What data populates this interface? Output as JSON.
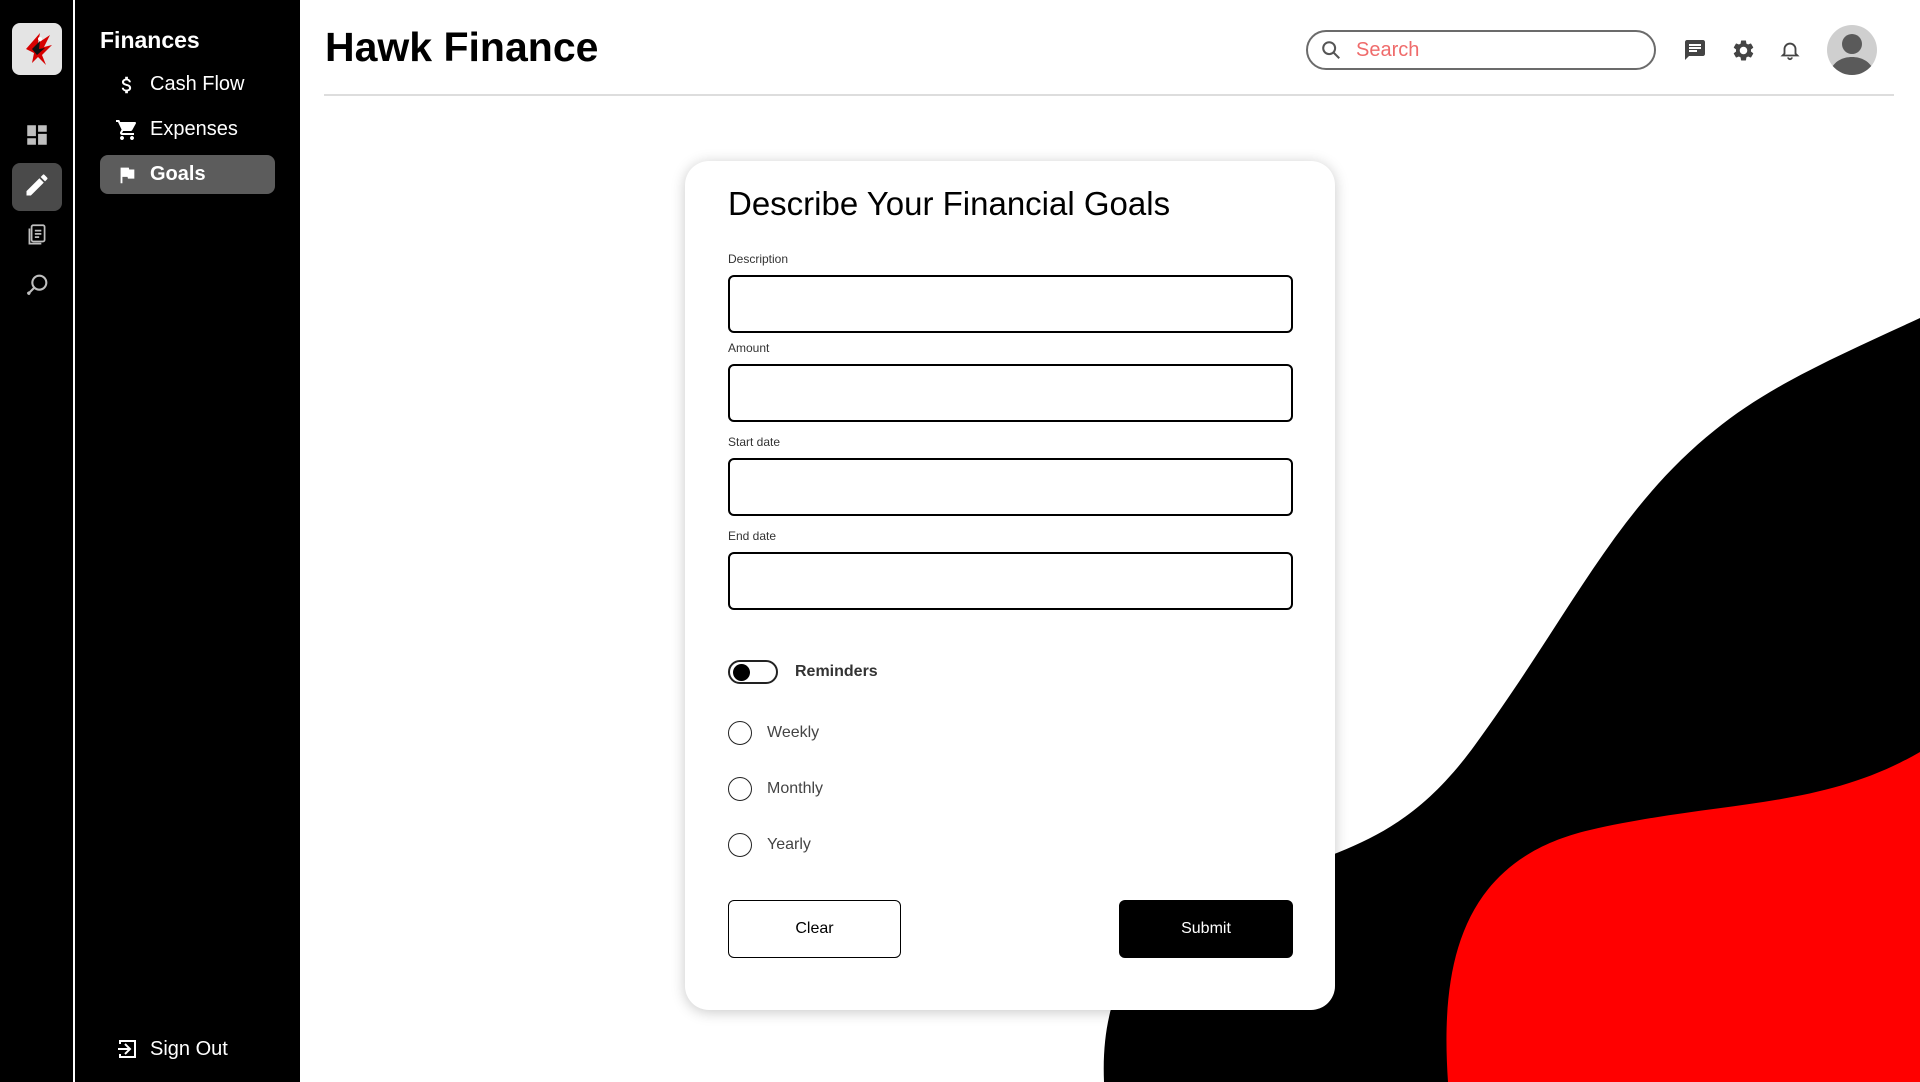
{
  "app": {
    "title": "Hawk Finance"
  },
  "colors": {
    "accent": "#ff0000",
    "dark": "#000000",
    "active_nav": "#5c5c5c"
  },
  "rail": {
    "logo": "hawk-logo",
    "items": [
      {
        "icon": "dashboard-icon",
        "active": false
      },
      {
        "icon": "pencil-icon",
        "active": true
      },
      {
        "icon": "documents-icon",
        "active": false
      },
      {
        "icon": "search-tag-icon",
        "active": false
      }
    ]
  },
  "nav": {
    "title": "Finances",
    "items": [
      {
        "label": "Cash Flow",
        "icon": "dollar-icon",
        "active": false
      },
      {
        "label": "Expenses",
        "icon": "cart-icon",
        "active": false
      },
      {
        "label": "Goals",
        "icon": "flag-icon",
        "active": true
      }
    ],
    "sign_out": "Sign Out"
  },
  "header": {
    "search_placeholder": "Search",
    "icons": [
      "chat-icon",
      "gear-icon",
      "bell-icon",
      "avatar"
    ]
  },
  "form": {
    "title": "Describe Your Financial Goals",
    "fields": [
      {
        "label": "Description",
        "value": ""
      },
      {
        "label": "Amount",
        "value": ""
      },
      {
        "label": "Start date",
        "value": ""
      },
      {
        "label": "End date",
        "value": ""
      }
    ],
    "reminders": {
      "label": "Reminders",
      "enabled": false
    },
    "frequency_options": [
      "Weekly",
      "Monthly",
      "Yearly"
    ],
    "clear_label": "Clear",
    "submit_label": "Submit"
  }
}
